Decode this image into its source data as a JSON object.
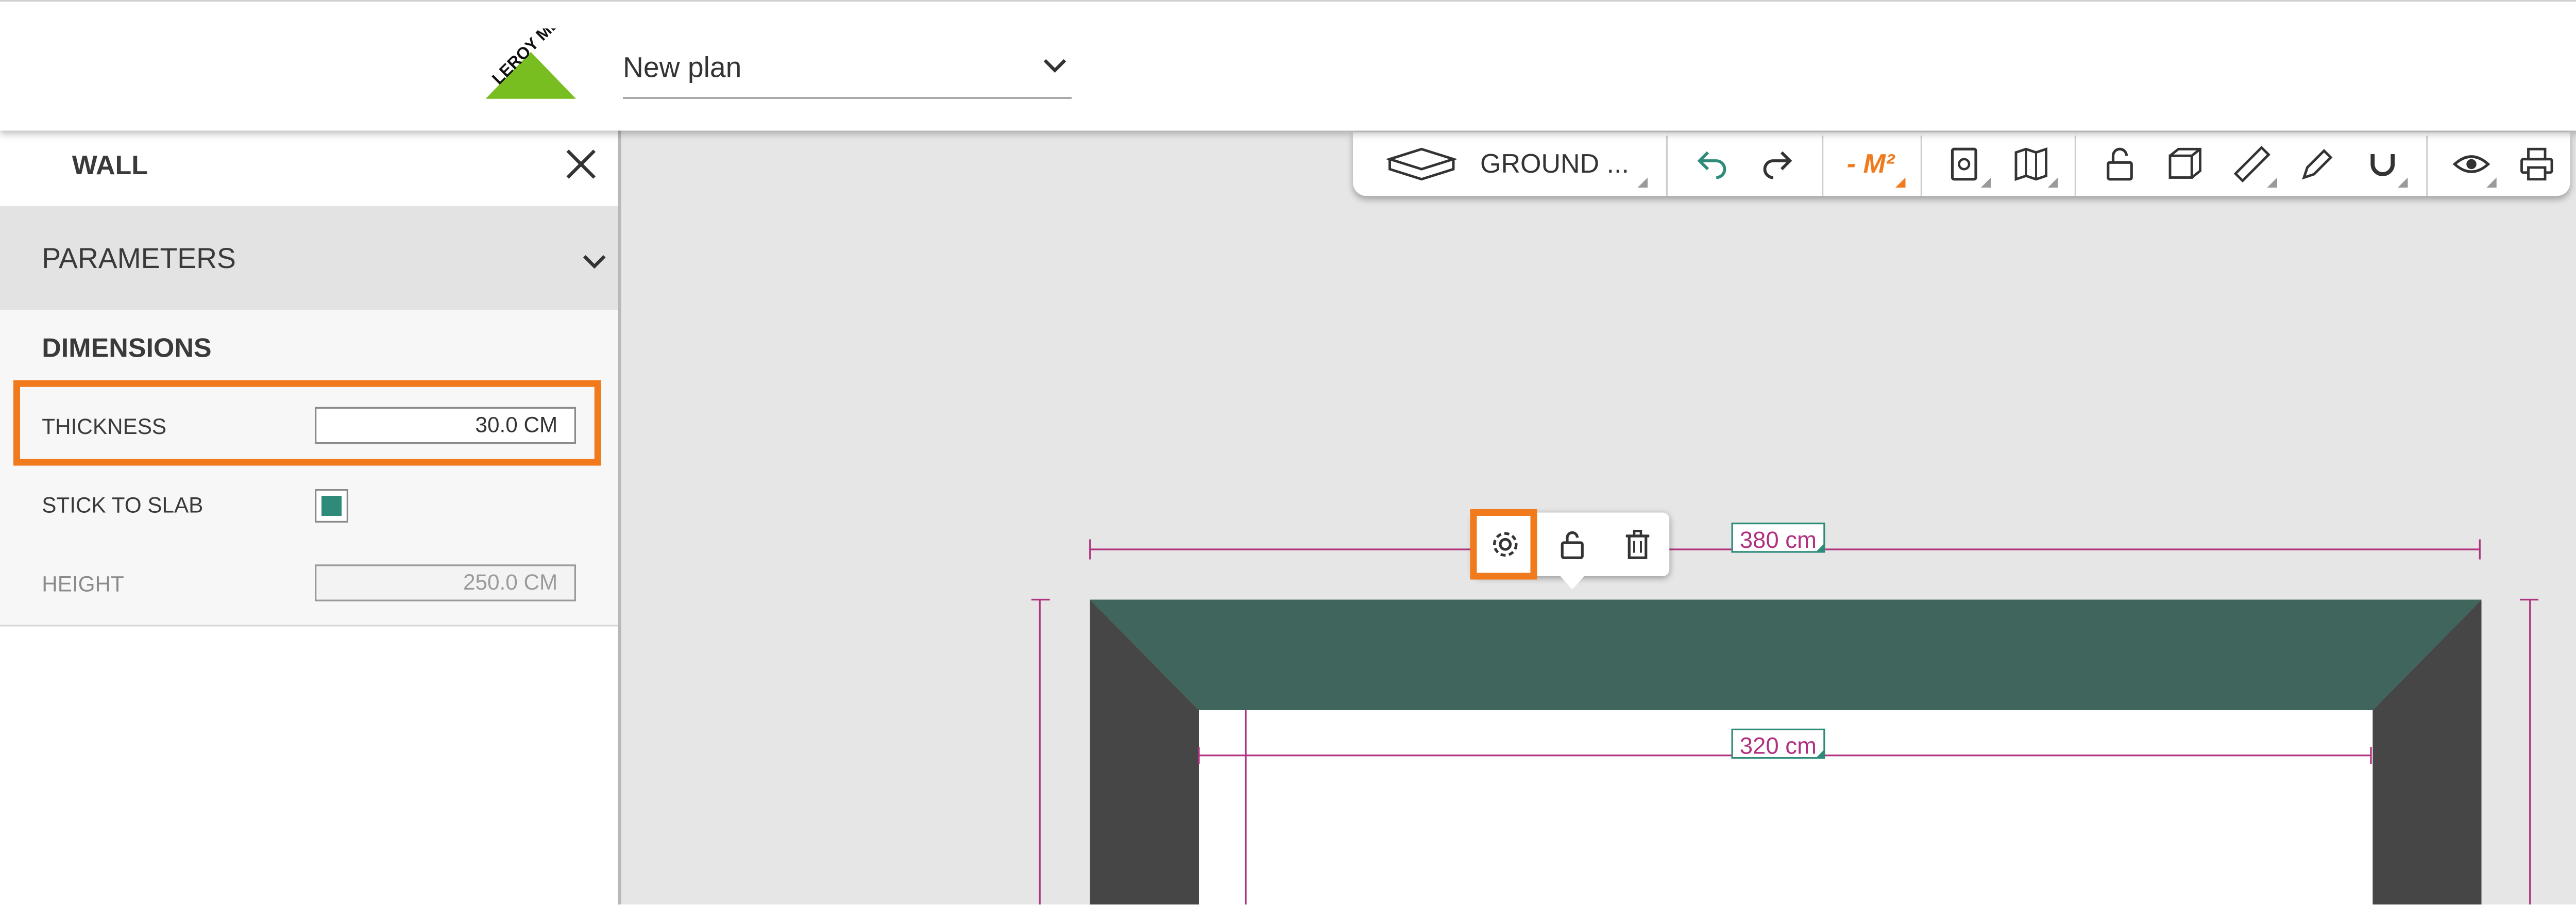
{
  "header": {
    "logo_text": "LEROY MERLIN",
    "plan_name": "New plan"
  },
  "panel": {
    "title": "WALL",
    "section_title": "PARAMETERS",
    "dimensions_title": "DIMENSIONS",
    "rows": {
      "thickness": {
        "label": "THICKNESS",
        "value": "30.0  CM"
      },
      "stick_to_slab": {
        "label": "STICK TO SLAB",
        "checked": true
      },
      "height": {
        "label": "HEIGHT",
        "value": "250.0  CM"
      }
    }
  },
  "toolbar": {
    "level": "GROUND ...",
    "area": "- M²",
    "icons": [
      "floor-level-icon",
      "undo-icon",
      "redo-icon",
      "area-icon",
      "document-icon",
      "map-icon",
      "unlock-icon",
      "3d-box-icon",
      "ruler-icon",
      "pen-icon",
      "magnet-icon",
      "eye-icon",
      "print-icon"
    ]
  },
  "wall_popup": {
    "icons": [
      "gear-icon",
      "unlock-icon",
      "trash-icon"
    ]
  },
  "dimensions": {
    "outer_width": "380 cm",
    "inner_width": "320 cm"
  },
  "colors": {
    "accent_orange": "#f07a1c",
    "teal": "#2e8b7a",
    "wall_selected": "#3f655c",
    "wall_dark": "#464646",
    "dimension_line": "#b0317f",
    "logo_green": "#78be20"
  }
}
